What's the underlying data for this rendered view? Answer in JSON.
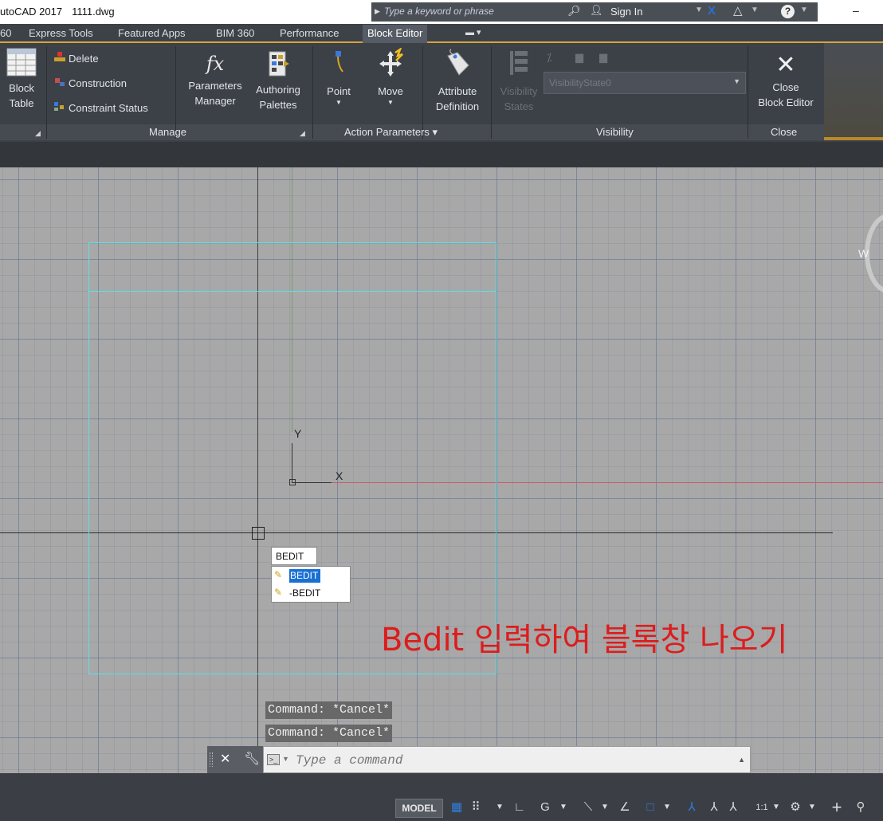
{
  "titlebar": {
    "app_title": "utoCAD 2017",
    "filename": "1111.dwg",
    "search_placeholder": "Type a keyword or phrase",
    "sign_in": "Sign In",
    "minimize": "–"
  },
  "tabs": [
    {
      "label": "60"
    },
    {
      "label": "Express Tools"
    },
    {
      "label": "Featured Apps"
    },
    {
      "label": "BIM 360"
    },
    {
      "label": "Performance"
    },
    {
      "label": "Block Editor"
    }
  ],
  "ribbon": {
    "block_table": {
      "line1": "Block",
      "line2": "Table"
    },
    "delete": "Delete",
    "construction": "Construction",
    "constraint_status": "Constraint Status",
    "parameters_manager": {
      "line1": "Parameters",
      "line2": "Manager"
    },
    "authoring_palettes": {
      "line1": "Authoring",
      "line2": "Palettes"
    },
    "point": "Point",
    "move": "Move",
    "attribute_definition": {
      "line1": "Attribute",
      "line2": "Definition"
    },
    "visibility_states": {
      "line1": "Visibility",
      "line2": "States"
    },
    "visibility_state_value": "VisibilityState0",
    "close_block_editor": {
      "line1": "Close",
      "line2": "Block Editor"
    },
    "panels": {
      "manage": "Manage",
      "action_parameters": "Action Parameters ▾",
      "visibility": "Visibility",
      "close": "Close"
    }
  },
  "canvas": {
    "ucs_x": "X",
    "ucs_y": "Y",
    "compass_w": "W",
    "autocomplete": {
      "typed": "BEDIT",
      "items": [
        {
          "label": "BEDIT",
          "selected": true
        },
        {
          "label": "-BEDIT",
          "selected": false
        }
      ]
    },
    "annotation": "Bedit 입력하여 블록창 나오기",
    "history": [
      "Command: *Cancel*",
      "Command: *Cancel*"
    ]
  },
  "command_line": {
    "placeholder": "Type a command"
  },
  "statusbar": {
    "model": "MODEL",
    "scale": "1:1"
  },
  "colors": {
    "accent_gold": "#d6a53b",
    "canvas": "#a8a8a8",
    "block_outline": "#59e1e6",
    "annotation": "#dd1c1c",
    "selection": "#1a6fd3"
  }
}
